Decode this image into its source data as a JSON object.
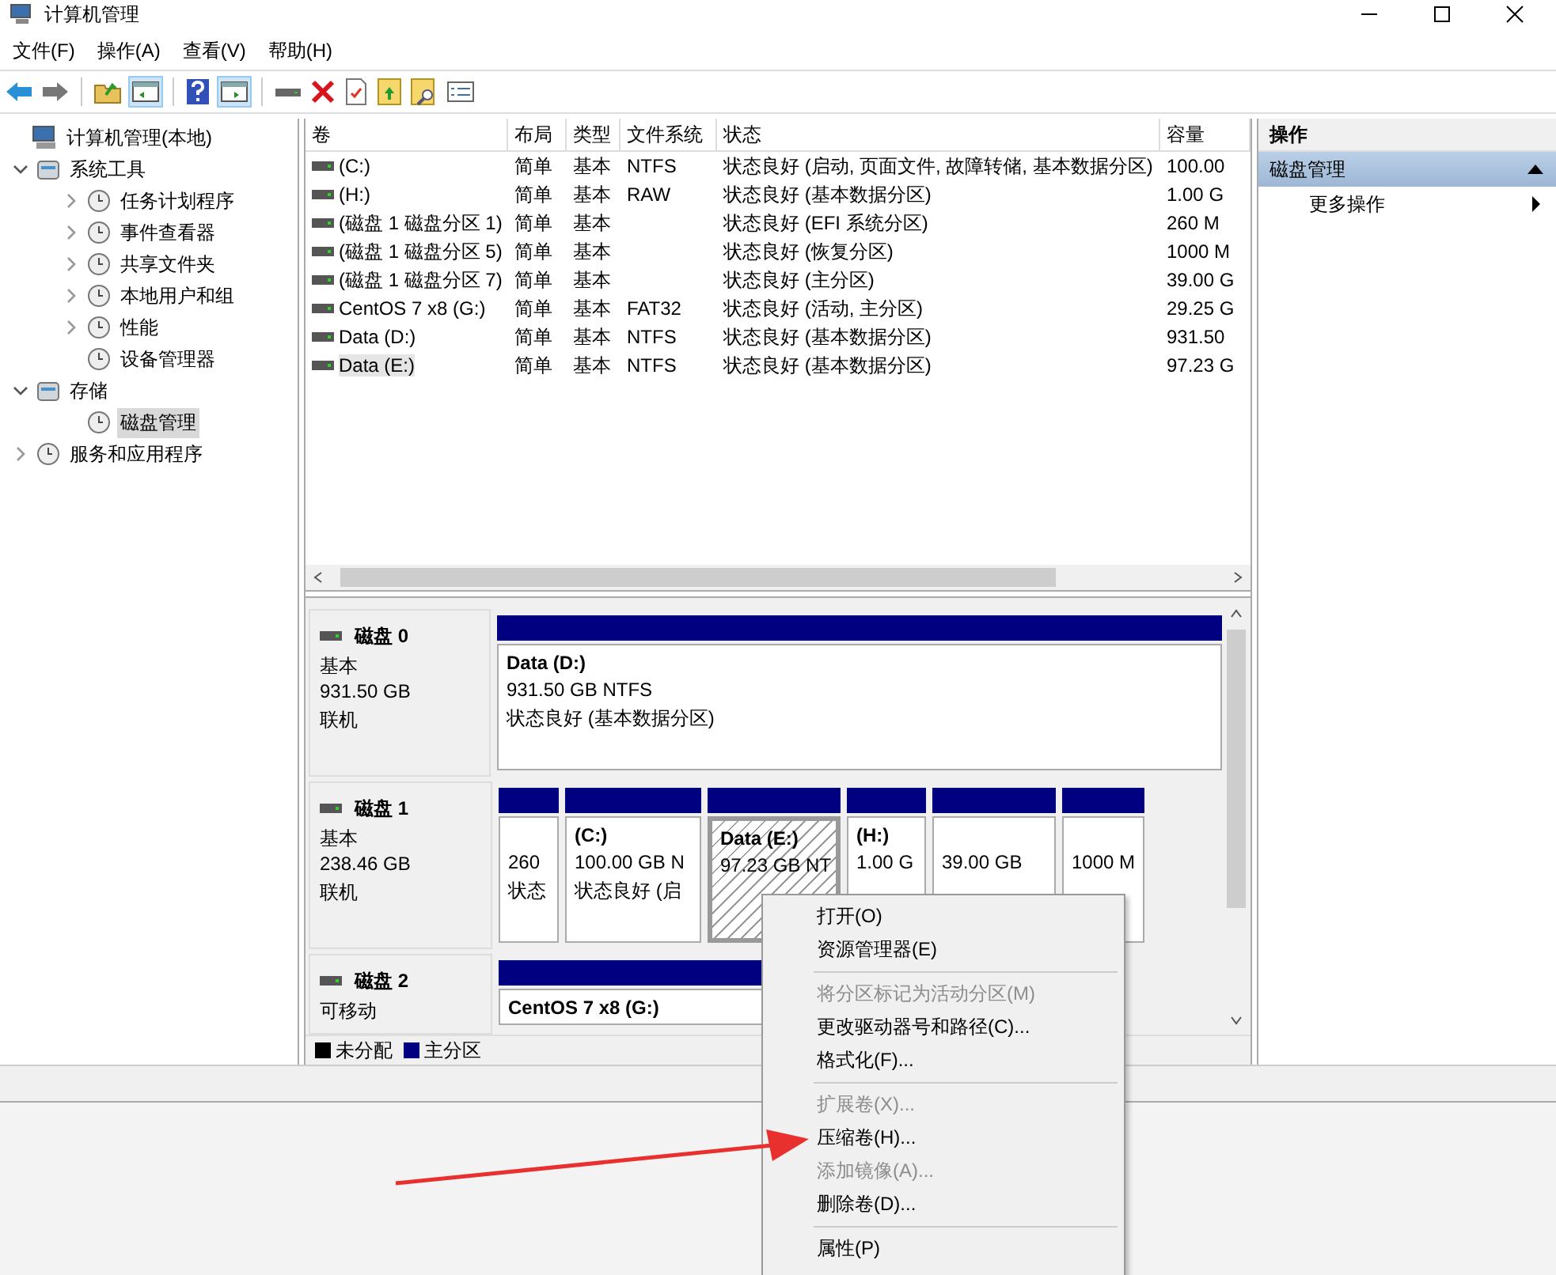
{
  "window": {
    "title": "计算机管理"
  },
  "menu": [
    "文件(F)",
    "操作(A)",
    "查看(V)",
    "帮助(H)"
  ],
  "tree": [
    {
      "label": "计算机管理(本地)",
      "selected": false,
      "children": [
        {
          "label": "系统工具",
          "selected": false,
          "expanded": true,
          "children": [
            {
              "label": "任务计划程序",
              "selected": false,
              "expanded": false
            },
            {
              "label": "事件查看器",
              "selected": false,
              "expanded": false
            },
            {
              "label": "共享文件夹",
              "selected": false,
              "expanded": false
            },
            {
              "label": "本地用户和组",
              "selected": false,
              "expanded": false
            },
            {
              "label": "性能",
              "selected": false,
              "expanded": false
            },
            {
              "label": "设备管理器",
              "selected": false
            }
          ]
        },
        {
          "label": "存储",
          "selected": false,
          "expanded": true,
          "children": [
            {
              "label": "磁盘管理",
              "selected": true
            }
          ]
        },
        {
          "label": "服务和应用程序",
          "selected": false,
          "expanded": false
        }
      ]
    }
  ],
  "volume_table": {
    "columns": [
      "卷",
      "布局",
      "类型",
      "文件系统",
      "状态",
      "容量"
    ],
    "rows": [
      {
        "cells": [
          " (C:)",
          "简单",
          "基本",
          "NTFS",
          "状态良好 (启动, 页面文件, 故障转储, 基本数据分区)",
          "100.00"
        ],
        "selected": false
      },
      {
        "cells": [
          " (H:)",
          "简单",
          "基本",
          "RAW",
          "状态良好 (基本数据分区)",
          "1.00 G"
        ],
        "selected": false
      },
      {
        "cells": [
          "(磁盘 1 磁盘分区 1)",
          "简单",
          "基本",
          "",
          "状态良好 (EFI 系统分区)",
          "260 M"
        ],
        "selected": false
      },
      {
        "cells": [
          "(磁盘 1 磁盘分区 5)",
          "简单",
          "基本",
          "",
          "状态良好 (恢复分区)",
          "1000 M"
        ],
        "selected": false
      },
      {
        "cells": [
          "(磁盘 1 磁盘分区 7)",
          "简单",
          "基本",
          "",
          "状态良好 (主分区)",
          "39.00 G"
        ],
        "selected": false
      },
      {
        "cells": [
          "CentOS 7 x8 (G:)",
          "简单",
          "基本",
          "FAT32",
          "状态良好 (活动, 主分区)",
          "29.25 G"
        ],
        "selected": false
      },
      {
        "cells": [
          "Data (D:)",
          "简单",
          "基本",
          "NTFS",
          "状态良好 (基本数据分区)",
          "931.50"
        ],
        "selected": false
      },
      {
        "cells": [
          "Data (E:)",
          "简单",
          "基本",
          "NTFS",
          "状态良好 (基本数据分区)",
          "97.23 G"
        ],
        "selected": true
      }
    ]
  },
  "disks": [
    {
      "name": "磁盘 0",
      "type": "基本",
      "size": "931.50 GB",
      "status": "联机",
      "partitions": [
        {
          "label": "Data  (D:)",
          "lines": [
            "931.50 GB NTFS",
            "状态良好 (基本数据分区)"
          ],
          "selected": false
        }
      ]
    },
    {
      "name": "磁盘 1",
      "type": "基本",
      "size": "238.46 GB",
      "status": "联机",
      "partitions": [
        {
          "lines": [
            "260",
            "状态"
          ],
          "selected": false
        },
        {
          "label": " (C:)",
          "lines": [
            "100.00 GB N",
            "状态良好 (启"
          ],
          "selected": false
        },
        {
          "label": "Data  (E:)",
          "lines": [
            "97.23 GB NT"
          ],
          "selected": true
        },
        {
          "label": " (H:)",
          "lines": [
            "1.00 G"
          ],
          "selected": false
        },
        {
          "lines": [
            "39.00 GB"
          ],
          "selected": false
        },
        {
          "lines": [
            "1000 M"
          ],
          "selected": false
        }
      ]
    },
    {
      "name": "磁盘 2",
      "type": "可移动",
      "partitions": [
        {
          "label": "CentOS 7 x8  (G:)",
          "selected": false
        }
      ]
    }
  ],
  "legend": [
    {
      "label": "未分配",
      "color": "#000000"
    },
    {
      "label": "主分区",
      "color": "#000080"
    }
  ],
  "actions": {
    "title": "操作",
    "section": "磁盘管理",
    "items": [
      "更多操作"
    ]
  },
  "context_menu": [
    {
      "kind": "item",
      "label": "打开(O)",
      "disabled": false
    },
    {
      "kind": "item",
      "label": "资源管理器(E)",
      "disabled": false
    },
    {
      "kind": "separator"
    },
    {
      "kind": "item",
      "label": "将分区标记为活动分区(M)",
      "disabled": true
    },
    {
      "kind": "item",
      "label": "更改驱动器号和路径(C)...",
      "disabled": false
    },
    {
      "kind": "item",
      "label": "格式化(F)...",
      "disabled": false
    },
    {
      "kind": "separator"
    },
    {
      "kind": "item",
      "label": "扩展卷(X)...",
      "disabled": true
    },
    {
      "kind": "item",
      "label": "压缩卷(H)...",
      "disabled": false
    },
    {
      "kind": "item",
      "label": "添加镜像(A)...",
      "disabled": true
    },
    {
      "kind": "item",
      "label": "删除卷(D)...",
      "disabled": false
    },
    {
      "kind": "separator"
    },
    {
      "kind": "item",
      "label": "属性(P)",
      "disabled": false
    }
  ]
}
